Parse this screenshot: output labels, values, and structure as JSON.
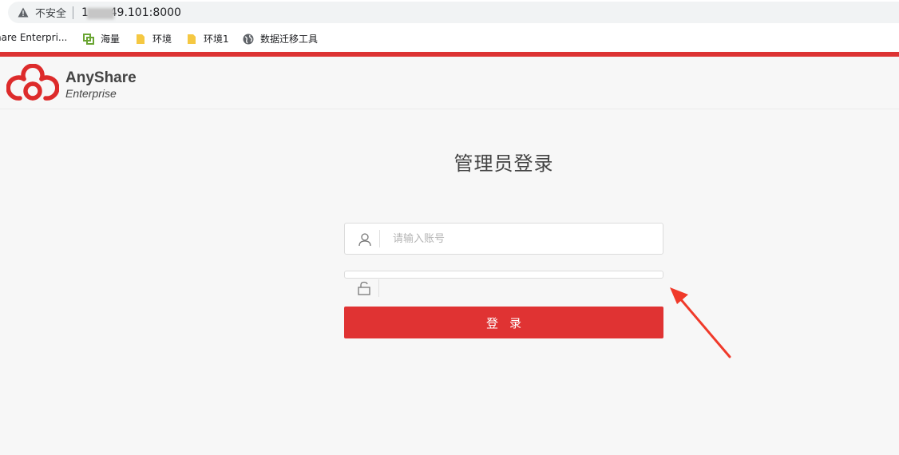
{
  "browser": {
    "security_label": "不安全",
    "url": "1      49.101:8000"
  },
  "bookmarks": [
    {
      "label": "hare Enterpri..."
    },
    {
      "label": "海量"
    },
    {
      "label": "环境"
    },
    {
      "label": "环境1"
    },
    {
      "label": "数据迁移工具"
    }
  ],
  "header": {
    "brand_name": "AnyShare",
    "brand_sub": "Enterprise"
  },
  "login": {
    "title": "管理员登录",
    "username_placeholder": "请输入账号",
    "password_value": "",
    "submit_label": "登录"
  },
  "colors": {
    "brand_red": "#e03333",
    "background": "#f7f7f7"
  }
}
